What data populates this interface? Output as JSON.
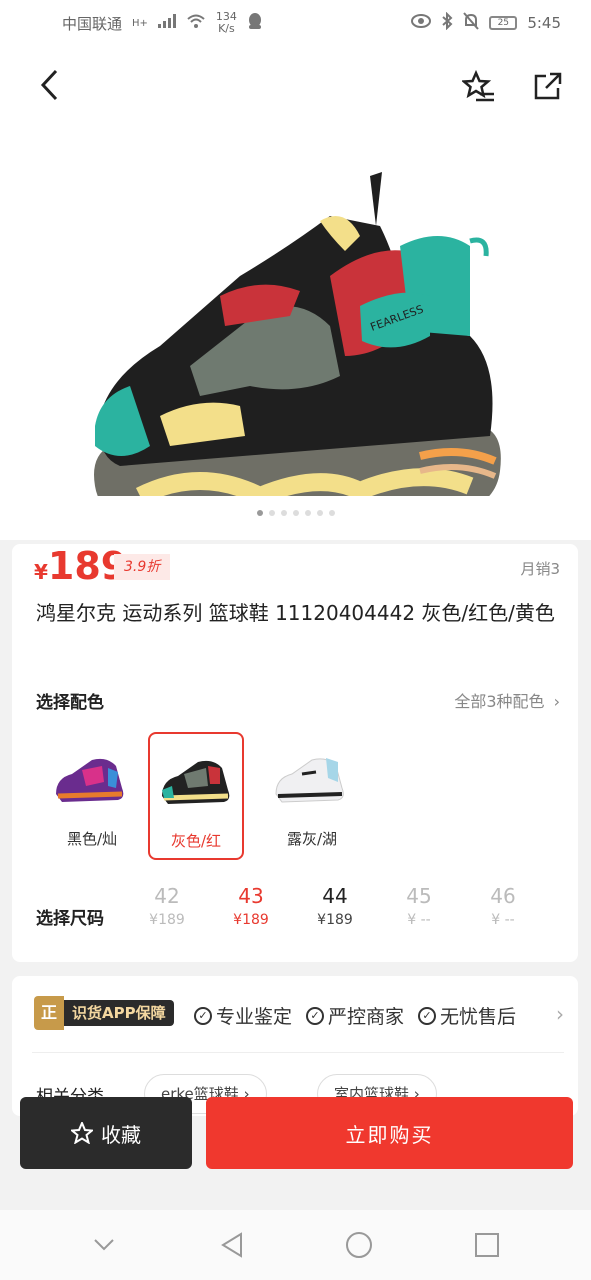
{
  "status_bar": {
    "carrier": "中国联通",
    "network": "H+",
    "speed_value": "134",
    "speed_unit": "K/s",
    "battery": "25",
    "time": "5:45"
  },
  "product": {
    "currency": "¥",
    "price": "189",
    "discount": "3.9折",
    "monthly_sales": "月销3",
    "title": "鸿星尔克 运动系列 篮球鞋 11120404442 灰色/红色/黄色"
  },
  "gallery": {
    "total": 7,
    "active_index": 0
  },
  "color_section": {
    "label": "选择配色",
    "all_label": "全部3种配色",
    "options": [
      {
        "name": "黑色/灿",
        "selected": false
      },
      {
        "name": "灰色/红",
        "selected": true
      },
      {
        "name": "露灰/湖",
        "selected": false
      }
    ]
  },
  "size_section": {
    "label": "选择尺码",
    "sizes": [
      {
        "size": "42",
        "price": "¥189",
        "state": "dim"
      },
      {
        "size": "43",
        "price": "¥189",
        "state": "selected"
      },
      {
        "size": "44",
        "price": "¥189",
        "state": "normal"
      },
      {
        "size": "45",
        "price": "¥ --",
        "state": "dim"
      },
      {
        "size": "46",
        "price": "¥ --",
        "state": "dim"
      }
    ]
  },
  "guarantee": {
    "badge_icon_text": "正",
    "badge_text": "识货APP保障",
    "items": [
      "专业鉴定",
      "严控商家",
      "无忧售后"
    ]
  },
  "related": {
    "label": "相关分类",
    "chips": [
      "erke篮球鞋",
      "室内篮球鞋"
    ]
  },
  "actions": {
    "favorite": "收藏",
    "buy": "立即购买"
  },
  "colors": {
    "accent": "#e8392f",
    "dark_button": "#2b2b2b"
  }
}
